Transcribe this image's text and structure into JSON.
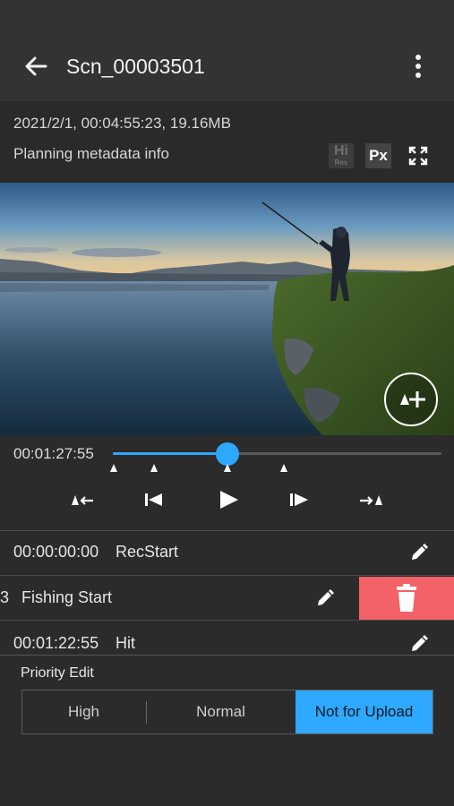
{
  "header": {
    "title": "Scn_00003501",
    "back_icon": "arrow-left-icon",
    "menu_icon": "more-vertical-icon"
  },
  "info": {
    "meta": "2021/2/1, 00:04:55:23,  19.16MB",
    "planning": "Planning metadata info",
    "hires_text": "Hi",
    "hires_sub": "Res",
    "px_text": "Px"
  },
  "player": {
    "timecode": "00:01:27:55",
    "progress_fraction": 0.35,
    "marker_fractions": [
      0.0,
      0.12,
      0.35,
      0.52
    ],
    "accent_color": "#2fa8ff"
  },
  "marks": [
    {
      "time": "00:00:00:00",
      "label": "RecStart"
    },
    {
      "time": "3",
      "label": "Fishing Start"
    },
    {
      "time": "00:01:22:55",
      "label": "Hit"
    }
  ],
  "delete_color": "#f26266",
  "priority": {
    "label": "Priority Edit",
    "options": [
      "High",
      "Normal",
      "Not for Upload"
    ],
    "selected": "Not for Upload",
    "selected_color": "#2fa8ff"
  }
}
